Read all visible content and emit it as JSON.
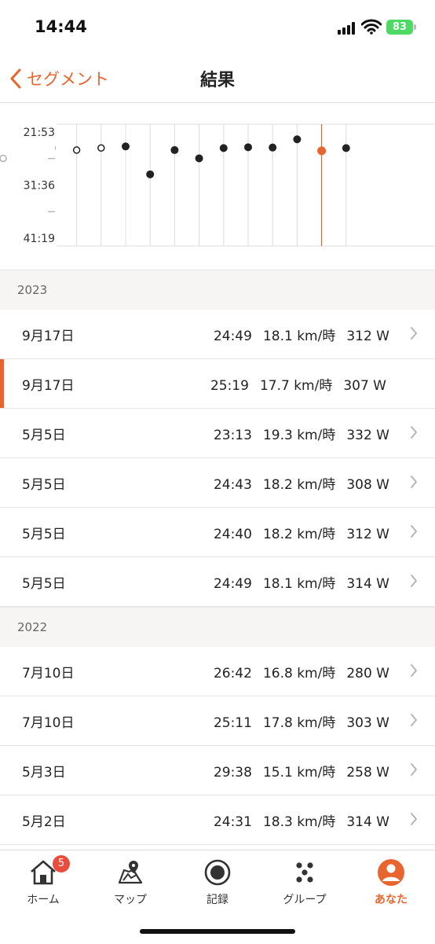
{
  "status_bar": {
    "time": "14:44",
    "battery": "83"
  },
  "nav": {
    "back_label": "セグメント",
    "title": "結果"
  },
  "chart_data": {
    "type": "scatter",
    "y_tick_labels": [
      "21:53",
      "31:36",
      "41:19"
    ],
    "y_ticks_seconds": [
      1313,
      1896,
      2479
    ],
    "ylim_seconds": [
      1313,
      2479
    ],
    "y_inverted": true,
    "accent": "#e8652f",
    "points": [
      {
        "time": "26:42",
        "style": "hollow"
      },
      {
        "time": "25:11",
        "style": "hollow"
      },
      {
        "time": "24:48",
        "style": "hollow"
      },
      {
        "time": "25:11",
        "style": "hollow"
      },
      {
        "time": "24:48",
        "style": "hollow"
      },
      {
        "time": "24:31",
        "style": "filled"
      },
      {
        "time": "29:38",
        "style": "filled"
      },
      {
        "time": "25:11",
        "style": "filled"
      },
      {
        "time": "26:42",
        "style": "filled"
      },
      {
        "time": "24:49",
        "style": "filled"
      },
      {
        "time": "24:40",
        "style": "filled"
      },
      {
        "time": "24:43",
        "style": "filled"
      },
      {
        "time": "23:13",
        "style": "filled"
      },
      {
        "time": "25:19",
        "style": "selected"
      },
      {
        "time": "24:49",
        "style": "filled"
      }
    ]
  },
  "results": [
    {
      "year": "2023",
      "rows": [
        {
          "date": "9月17日",
          "time": "24:49",
          "speed": "18.1 km/時",
          "power": "312 W",
          "selected": false
        },
        {
          "date": "9月17日",
          "time": "25:19",
          "speed": "17.7 km/時",
          "power": "307 W",
          "selected": true
        },
        {
          "date": "5月5日",
          "time": "23:13",
          "speed": "19.3 km/時",
          "power": "332 W",
          "selected": false
        },
        {
          "date": "5月5日",
          "time": "24:43",
          "speed": "18.2 km/時",
          "power": "308 W",
          "selected": false
        },
        {
          "date": "5月5日",
          "time": "24:40",
          "speed": "18.2 km/時",
          "power": "312 W",
          "selected": false
        },
        {
          "date": "5月5日",
          "time": "24:49",
          "speed": "18.1 km/時",
          "power": "314 W",
          "selected": false
        }
      ]
    },
    {
      "year": "2022",
      "rows": [
        {
          "date": "7月10日",
          "time": "26:42",
          "speed": "16.8 km/時",
          "power": "280 W",
          "selected": false
        },
        {
          "date": "7月10日",
          "time": "25:11",
          "speed": "17.8 km/時",
          "power": "303 W",
          "selected": false
        },
        {
          "date": "5月3日",
          "time": "29:38",
          "speed": "15.1 km/時",
          "power": "258 W",
          "selected": false
        },
        {
          "date": "5月2日",
          "time": "24:31",
          "speed": "18.3 km/時",
          "power": "314 W",
          "selected": false
        }
      ]
    }
  ],
  "tabs": [
    {
      "key": "home",
      "label": "ホーム",
      "icon": "home-icon",
      "badge": "5",
      "active": false
    },
    {
      "key": "map",
      "label": "マップ",
      "icon": "map-icon",
      "active": false
    },
    {
      "key": "record",
      "label": "記録",
      "icon": "record-icon",
      "active": false
    },
    {
      "key": "groups",
      "label": "グループ",
      "icon": "groups-icon",
      "active": false
    },
    {
      "key": "you",
      "label": "あなた",
      "icon": "profile-icon",
      "active": true
    }
  ],
  "colors": {
    "accent": "#e8652f",
    "badge": "#e84c3d"
  }
}
